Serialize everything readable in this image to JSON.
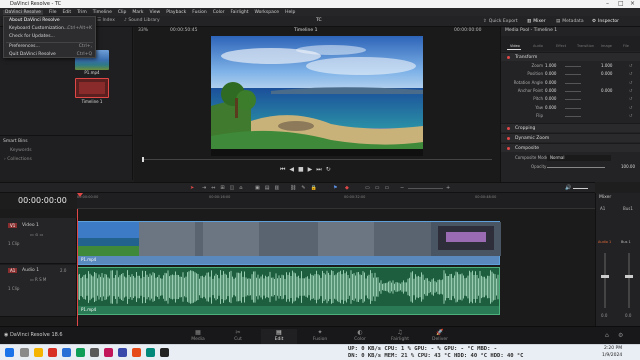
{
  "window": {
    "title": "DaVinci Resolve - TC"
  },
  "menu": [
    "DaVinci Resolve",
    "File",
    "Edit",
    "Trim",
    "Timeline",
    "Clip",
    "Mark",
    "View",
    "Playback",
    "Fusion",
    "Color",
    "Fairlight",
    "Workspace",
    "Help"
  ],
  "dropdown": [
    {
      "label": "About DaVinci Resolve",
      "shortcut": ""
    },
    {
      "label": "Keyboard Customization...",
      "shortcut": "Ctrl+Alt+K"
    },
    {
      "label": "Check for Updates...",
      "shortcut": ""
    },
    {
      "label": "Preferences...",
      "shortcut": "Ctrl+,"
    },
    {
      "label": "Quit DaVinci Resolve",
      "shortcut": "Ctrl+Q"
    }
  ],
  "toolbar": {
    "index": "Index",
    "sound_library": "Sound Library",
    "project": "TC",
    "quick_export": "Quick Export",
    "mixer": "Mixer",
    "metadata": "Metadata",
    "inspector": "Inspector"
  },
  "viewer": {
    "zoom": "33%",
    "timecode": "00:00:50:45",
    "timeline_name": "Timeline 1",
    "right_tc": "00:00:00:00"
  },
  "media_pool": {
    "clips": [
      {
        "label": "P1.mp4"
      },
      {
        "label": "Timeline 1"
      }
    ]
  },
  "smart_bins": {
    "title": "Smart Bins",
    "items": [
      "Keywords",
      "Collections"
    ]
  },
  "inspector": {
    "header": "Media Pool - Timeline 1",
    "tabs": [
      "Video",
      "Audio",
      "Effect",
      "Transition",
      "Image",
      "File"
    ],
    "transform_title": "Transform",
    "rows": [
      {
        "label": "Zoom",
        "x": "1.000",
        "y": "1.000"
      },
      {
        "label": "Position",
        "x": "0.000",
        "y": "0.000"
      },
      {
        "label": "Rotation Angle",
        "x": "0.000",
        "y": ""
      },
      {
        "label": "Anchor Point",
        "x": "0.000",
        "y": "0.000"
      },
      {
        "label": "Pitch",
        "x": "0.000",
        "y": ""
      },
      {
        "label": "Yaw",
        "x": "0.000",
        "y": ""
      },
      {
        "label": "Flip",
        "x": "",
        "y": ""
      }
    ],
    "sections": [
      "Cropping",
      "Dynamic Zoom",
      "Composite"
    ],
    "composite_mode_label": "Composite Mode",
    "composite_mode_value": "Normal",
    "opacity_label": "Opacity",
    "opacity_value": "100.00"
  },
  "timeline": {
    "timecode": "00:00:00:00",
    "ruler": [
      "00:00:00:00",
      "00:00:16:00",
      "00:00:32:00",
      "00:00:48:00"
    ],
    "video_track": {
      "id": "V1",
      "name": "Video 1",
      "clips": "1 Clip",
      "clip_label": "P1.mp4"
    },
    "audio_track": {
      "id": "A1",
      "name": "Audio 1",
      "level": "2.0",
      "clips": "1 Clip",
      "clip_label": "P1.mp4"
    }
  },
  "mixer": {
    "title": "Mixer",
    "channels": [
      "A1",
      "Bus1"
    ],
    "ch_label": "Audio 1",
    "bus_label": "Bus 1",
    "values": [
      "0.0",
      "0.0"
    ]
  },
  "pages": [
    "Media",
    "Cut",
    "Edit",
    "Fusion",
    "Color",
    "Fairlight",
    "Deliver"
  ],
  "active_page": "Edit",
  "app_badge": "DaVinci Resolve 18.6",
  "hud": {
    "line1": "UP: 0 KB/s  CPU: 1 %   GPU: - %  GPU: - °C  MBD: -",
    "line2": "DN: 0 KB/s  MEM: 21 % CPU: 43 °C HDD: 40 °C  HDD: 40 °C"
  },
  "clock": {
    "time": "2:20 PM",
    "date": "1/9/2024"
  },
  "colors": {
    "accent": "#e04848",
    "clip_audio": "#3a8f6a",
    "clip_video": "#3b6f9e",
    "active_page": "#e0e0e0"
  }
}
